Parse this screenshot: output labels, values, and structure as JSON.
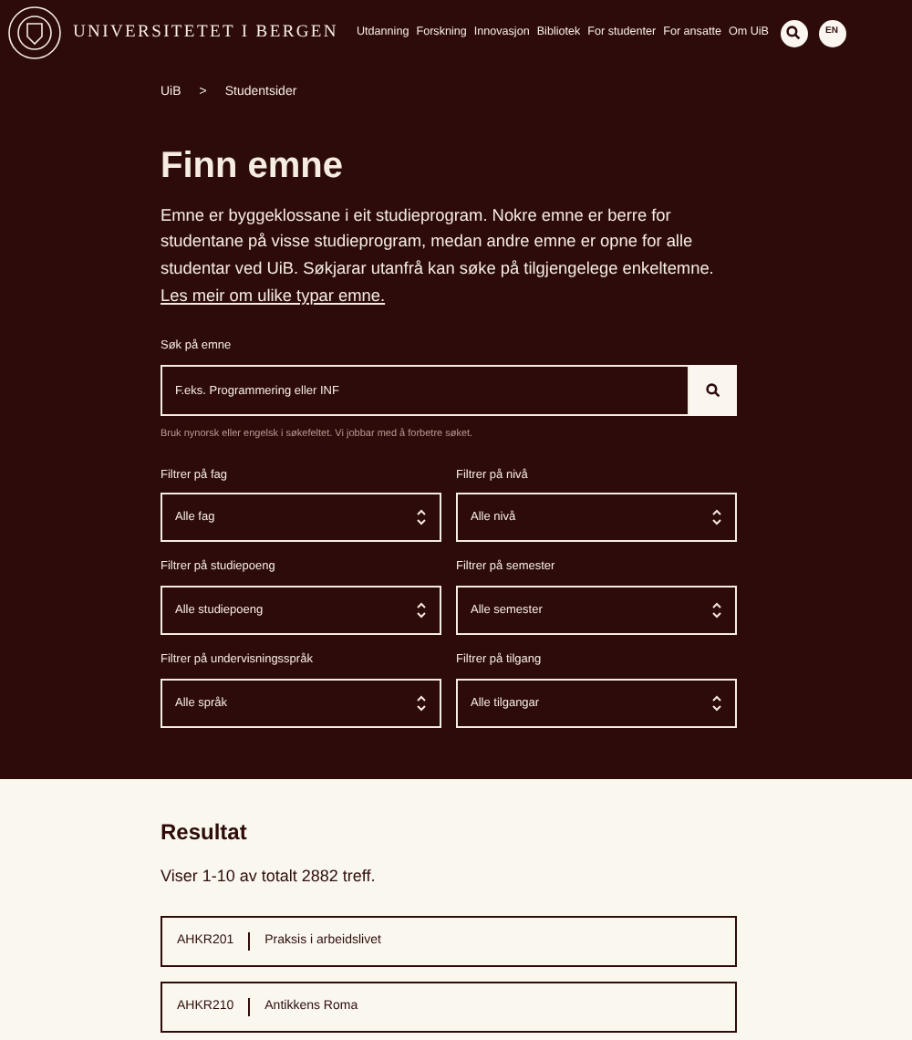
{
  "header": {
    "logo_text": "UNIVERSITETET I BERGEN",
    "nav": [
      "Utdanning",
      "Forskning",
      "Innovasjon",
      "Bibliotek",
      "For studenter",
      "For ansatte",
      "Om UiB"
    ],
    "language_button": "EN"
  },
  "breadcrumb": {
    "items": [
      "UiB",
      "Studentsider"
    ],
    "separator": ">"
  },
  "title": "Finn emne",
  "intro": {
    "text": "Emne er byggeklossane i eit studieprogram. Nokre emne er berre for studentane på visse studieprogram, medan andre emne er opne for alle studentar ved UiB. Søkjarar utanfrå kan søke på tilgjengelege enkeltemne.",
    "link": "Les meir om ulike typar emne."
  },
  "search": {
    "label": "Søk på emne",
    "placeholder": "F.eks. Programmering eller INF",
    "hint": "Bruk nynorsk eller engelsk i søkefeltet. Vi jobbar med å forbetre søket."
  },
  "filters": [
    {
      "label": "Filtrer på fag",
      "value": "Alle fag"
    },
    {
      "label": "Filtrer på nivå",
      "value": "Alle nivå"
    },
    {
      "label": "Filtrer på studiepoeng",
      "value": "Alle studiepoeng"
    },
    {
      "label": "Filtrer på semester",
      "value": "Alle semester"
    },
    {
      "label": "Filtrer på undervisningsspråk",
      "value": "Alle språk"
    },
    {
      "label": "Filtrer på tilgang",
      "value": "Alle tilgangar"
    }
  ],
  "results": {
    "title": "Resultat",
    "summary": "Viser 1-10 av totalt 2882 treff.",
    "rows": [
      {
        "code": "AHKR201",
        "name": "Praksis i arbeidslivet"
      },
      {
        "code": "AHKR210",
        "name": "Antikkens Roma"
      }
    ]
  }
}
